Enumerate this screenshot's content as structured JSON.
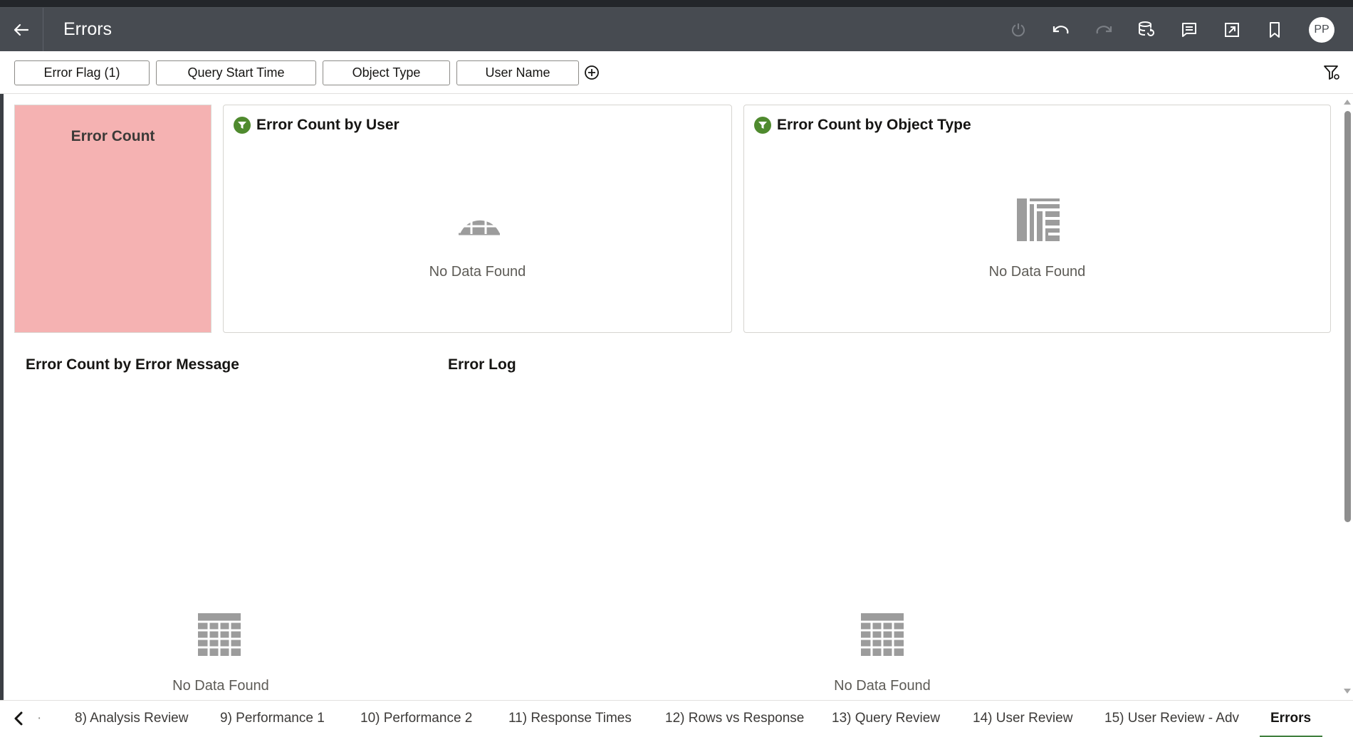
{
  "header": {
    "title": "Errors",
    "user_initials": "PP"
  },
  "filters": {
    "pills": [
      "Error Flag (1)",
      "Query Start Time",
      "Object Type",
      "User Name"
    ]
  },
  "tiles": {
    "error_count": {
      "title": "Error Count",
      "color": "#f5b2b2"
    }
  },
  "visualizations": {
    "by_user": {
      "title": "Error Count by User",
      "empty_text": "No Data Found",
      "icon": "filled-map-icon"
    },
    "by_object_type": {
      "title": "Error Count by Object Type",
      "empty_text": "No Data Found",
      "icon": "treemap-icon"
    },
    "by_error_message": {
      "title": "Error Count by Error Message",
      "empty_text": "No Data Found",
      "icon": "table-grid-icon"
    },
    "error_log": {
      "title": "Error Log",
      "empty_text": "No Data Found",
      "icon": "table-grid-icon"
    }
  },
  "tabs": {
    "partial_left": "·",
    "items": [
      "8) Analysis Review",
      "9) Performance 1",
      "10) Performance 2",
      "11) Response Times",
      "12) Rows vs Response",
      "13) Query Review",
      "14) User Review",
      "15) User Review - Adv",
      "Errors"
    ],
    "active": "Errors"
  },
  "colors": {
    "header_bg": "#474b51",
    "filter_badge": "#4f8a2e",
    "active_tab_underline": "#3f7f3d"
  }
}
